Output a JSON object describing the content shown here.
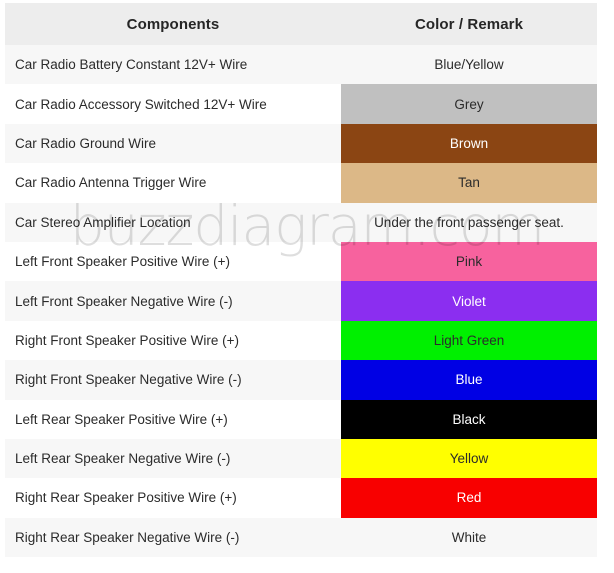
{
  "table": {
    "headers": {
      "components": "Components",
      "color_remark": "Color / Remark"
    },
    "rows": [
      {
        "component": "Car Radio Battery Constant 12V+ Wire",
        "color_label": "Blue/Yellow",
        "swatch": null,
        "text_color": "#2b2b2b"
      },
      {
        "component": "Car Radio Accessory Switched 12V+ Wire",
        "color_label": "Grey",
        "swatch": "#c0c0c0",
        "text_color": "#2b2b2b"
      },
      {
        "component": "Car Radio Ground Wire",
        "color_label": "Brown",
        "swatch": "#8b4513",
        "text_color": "#ffffff"
      },
      {
        "component": "Car Radio Antenna Trigger Wire",
        "color_label": "Tan",
        "swatch": "#dcb887",
        "text_color": "#2b2b2b"
      },
      {
        "component": "Car Stereo Amplifier Location",
        "color_label": "Under the front passenger seat.",
        "swatch": null,
        "text_color": "#2b2b2b"
      },
      {
        "component": "Left Front Speaker Positive Wire (+)",
        "color_label": "Pink",
        "swatch": "#f7629e",
        "text_color": "#2b2b2b"
      },
      {
        "component": "Left Front Speaker Negative Wire (-)",
        "color_label": "Violet",
        "swatch": "#8b2ef0",
        "text_color": "#ffffff"
      },
      {
        "component": "Right Front Speaker Positive Wire (+)",
        "color_label": "Light Green",
        "swatch": "#00f000",
        "text_color": "#2b2b2b"
      },
      {
        "component": "Right Front Speaker Negative Wire (-)",
        "color_label": "Blue",
        "swatch": "#0000e4",
        "text_color": "#ffffff"
      },
      {
        "component": "Left Rear Speaker Positive Wire (+)",
        "color_label": "Black",
        "swatch": "#000000",
        "text_color": "#ffffff"
      },
      {
        "component": "Left Rear Speaker Negative Wire (-)",
        "color_label": "Yellow",
        "swatch": "#ffff00",
        "text_color": "#2b2b2b"
      },
      {
        "component": "Right Rear Speaker Positive Wire (+)",
        "color_label": "Red",
        "swatch": "#f80000",
        "text_color": "#ffffff"
      },
      {
        "component": "Right Rear Speaker Negative Wire (-)",
        "color_label": "White",
        "swatch": null,
        "text_color": "#2b2b2b"
      }
    ]
  },
  "watermark": {
    "text": "buzzdiagram.com"
  }
}
